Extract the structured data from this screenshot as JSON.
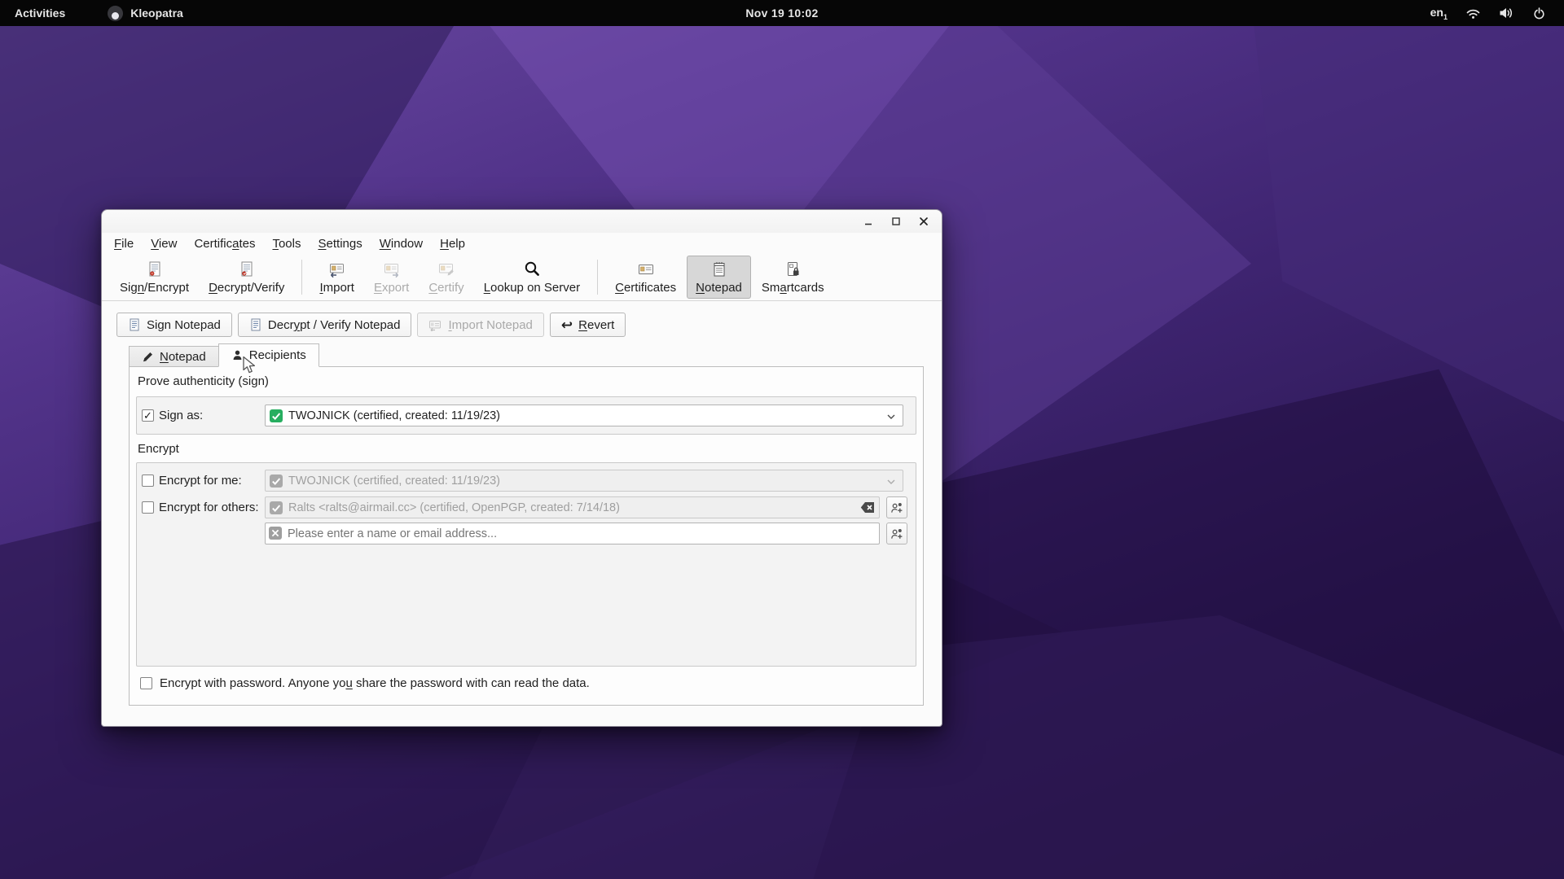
{
  "colors": {
    "accent_green": "#27ae60",
    "seal_red": "#c0392b",
    "card_tan": "#d4b06a",
    "topbar_bg": "#060606",
    "window_bg": "#fbfbfb"
  },
  "topbar": {
    "activities": "Activities",
    "app_name": "Kleopatra",
    "clock": "Nov 19 10:02",
    "keyboard": {
      "label": "en",
      "sub": "1"
    },
    "icons": [
      "wifi-icon",
      "volume-icon",
      "power-icon"
    ]
  },
  "win": {
    "menus": [
      {
        "label": "File",
        "mnemonic": "F"
      },
      {
        "label": "View",
        "mnemonic": "V"
      },
      {
        "label": "Certificates",
        "mnemonic": "a"
      },
      {
        "label": "Tools",
        "mnemonic": "T"
      },
      {
        "label": "Settings",
        "mnemonic": "S"
      },
      {
        "label": "Window",
        "mnemonic": "W"
      },
      {
        "label": "Help",
        "mnemonic": "H"
      }
    ],
    "toolbar": [
      {
        "label": "Sign/Encrypt",
        "mnemonic": "n",
        "enabled": true
      },
      {
        "label": "Decrypt/Verify",
        "mnemonic": "D",
        "enabled": true
      },
      {
        "label": "Import",
        "mnemonic": "I",
        "enabled": true
      },
      {
        "label": "Export",
        "mnemonic": "E",
        "enabled": false
      },
      {
        "label": "Certify",
        "mnemonic": "C",
        "enabled": false
      },
      {
        "label": "Lookup on Server",
        "mnemonic": "L",
        "enabled": true
      },
      {
        "label": "Certificates",
        "mnemonic": "C",
        "enabled": true
      },
      {
        "label": "Notepad",
        "mnemonic": "N",
        "enabled": true,
        "active": true
      },
      {
        "label": "Smartcards",
        "mnemonic": "a",
        "enabled": true
      }
    ],
    "actions": [
      {
        "label": "Sign Notepad",
        "enabled": true
      },
      {
        "label": "Decrypt / Verify Notepad",
        "mnemonic": "y",
        "enabled": true
      },
      {
        "label": "Import Notepad",
        "mnemonic": "I",
        "enabled": false
      },
      {
        "label": "Revert",
        "mnemonic": "R",
        "enabled": true
      }
    ],
    "tabs": [
      {
        "label": "Notepad",
        "mnemonic": "N",
        "active": false
      },
      {
        "label": "Recipients",
        "active": true
      }
    ],
    "recipients": {
      "sign_section_title": "Prove authenticity (sign)",
      "sign_as": {
        "label": "Sign as:",
        "checked": true,
        "value": "TWOJNICK (certified, created: 11/19/23)"
      },
      "encrypt_section_title": "Encrypt",
      "encrypt_for_me": {
        "label": "Encrypt for me:",
        "checked": false,
        "value": "TWOJNICK (certified, created: 11/19/23)"
      },
      "encrypt_for_others": {
        "label": "Encrypt for others:",
        "checked": false,
        "recipient": "Ralts <ralts@airmail.cc> (certified, OpenPGP, created: 7/14/18)",
        "placeholder": "Please enter a name or email address..."
      },
      "password_checkbox": {
        "label": "Encrypt with password. Anyone you share the password with can read the data.",
        "mnemonic": "u",
        "checked": false
      }
    }
  }
}
